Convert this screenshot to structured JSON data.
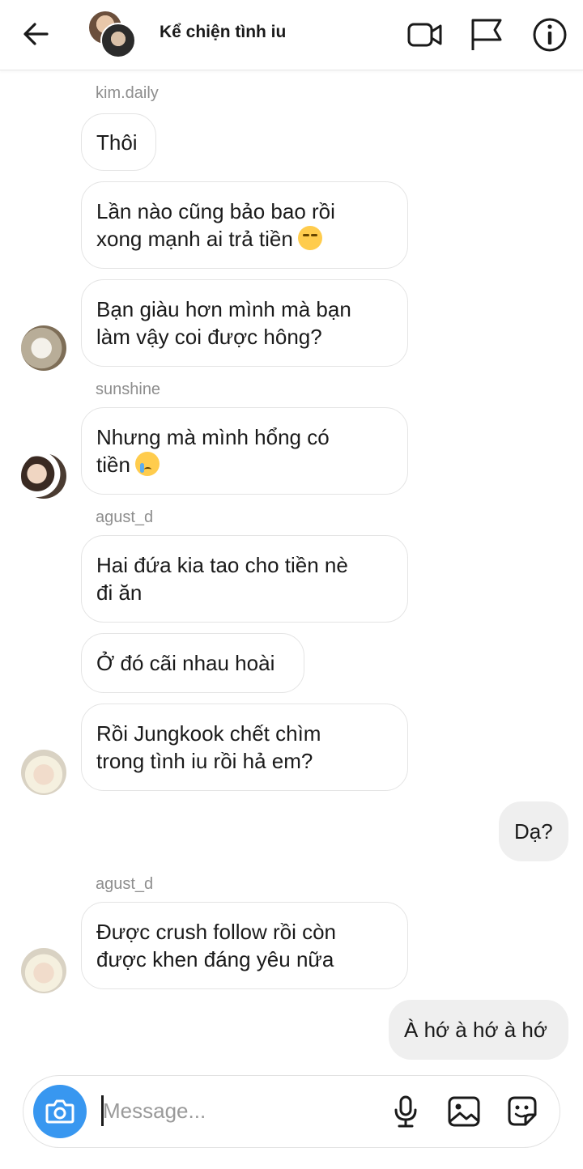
{
  "header": {
    "title": "Kể chiện tình iu",
    "icons": [
      "back-arrow-icon",
      "video-call-icon",
      "flag-icon",
      "info-icon"
    ]
  },
  "messages": [
    {
      "sender": "kim.daily",
      "text": "Thôi"
    },
    {
      "text": "Lần nào cũng bảo bao rồi\nxong mạnh ai trả tiền",
      "emoji": "unamused-face"
    },
    {
      "text": "Bạn giàu hơn mình mà bạn\nlàm vậy coi được hông?"
    },
    {
      "sender": "sunshine",
      "text": "Nhưng mà mình hổng có\ntiền",
      "emoji": "crying-face"
    },
    {
      "sender": "agust_d",
      "text": "Hai đứa kia tao cho tiền nè\nđi ăn"
    },
    {
      "text": "Ở đó cãi nhau hoài"
    },
    {
      "text": "Rồi Jungkook chết chìm\ntrong tình iu rồi hả em?"
    },
    {
      "outgoing": true,
      "text": "Dạ?"
    },
    {
      "sender": "agust_d",
      "text": "Được crush follow rồi còn\nđược khen đáng yêu nữa"
    },
    {
      "outgoing": true,
      "text": "À hớ à hớ à hớ"
    }
  ],
  "composer": {
    "placeholder": "Message...",
    "value": "",
    "accent": "#3897f0",
    "icons": [
      "camera-icon",
      "microphone-icon",
      "gallery-icon",
      "sticker-icon"
    ]
  }
}
